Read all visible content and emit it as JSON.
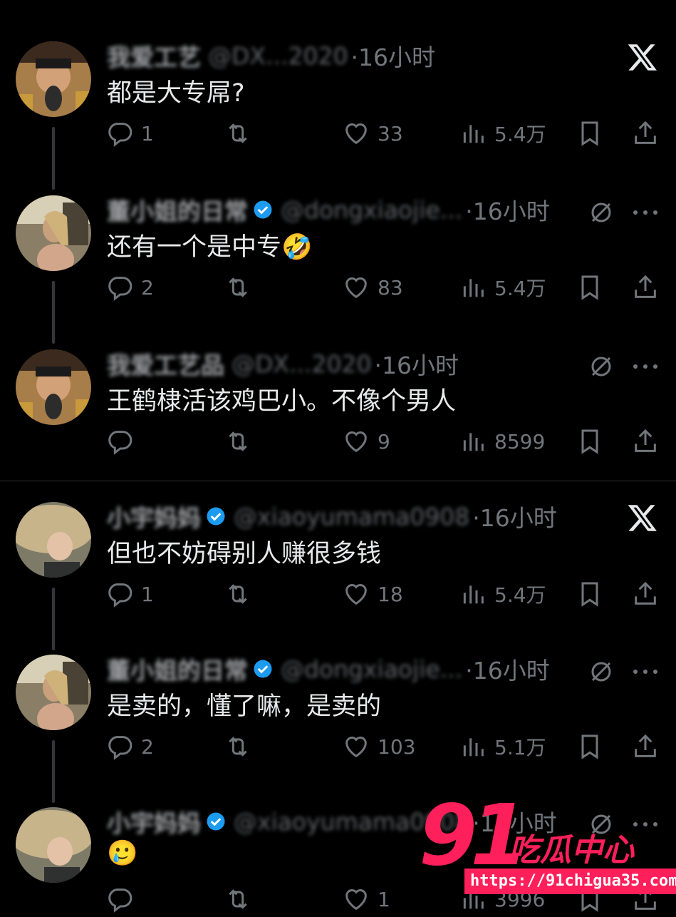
{
  "colors": {
    "background": "#000000",
    "text": "#e7e9ea",
    "muted": "#71767b",
    "verified": "#1d9bf0",
    "watermark": "#ff1f5a"
  },
  "threads": [
    {
      "posts": [
        {
          "name": "我爱工艺",
          "handle": "@DX...2020",
          "time": "·16小时",
          "text": "都是大专屌?",
          "replies": "1",
          "retweets": "",
          "likes": "33",
          "views": "5.4万",
          "corner": "x-logo",
          "verified": false,
          "avatar": "man"
        },
        {
          "name": "董小姐的日常",
          "handle": "@dongxiaojie...",
          "time": "·16小时",
          "text": "还有一个是中专🤣",
          "replies": "2",
          "retweets": "",
          "likes": "83",
          "views": "5.4万",
          "corner": "grok",
          "verified": true,
          "avatar": "woman"
        },
        {
          "name": "我爱工艺品",
          "handle": "@DX...2020",
          "time": "·16小时",
          "text": "王鹤棣活该鸡巴小。不像个男人",
          "replies": "",
          "retweets": "",
          "likes": "9",
          "views": "8599",
          "corner": "grok",
          "verified": false,
          "avatar": "man"
        }
      ]
    },
    {
      "posts": [
        {
          "name": "小宇妈妈",
          "handle": "@xiaoyumama0908",
          "time": "·16小时",
          "text": "但也不妨碍别人赚很多钱",
          "replies": "1",
          "retweets": "",
          "likes": "18",
          "views": "5.4万",
          "corner": "x-logo",
          "verified": true,
          "avatar": "hat"
        },
        {
          "name": "董小姐的日常",
          "handle": "@dongxiaojie...",
          "time": "·16小时",
          "text": "是卖的，懂了嘛，是卖的",
          "replies": "2",
          "retweets": "",
          "likes": "103",
          "views": "5.1万",
          "corner": "grok",
          "verified": true,
          "avatar": "woman"
        },
        {
          "name": "小宇妈妈",
          "handle": "@xiaoyumama0908",
          "time": "·16小时",
          "text": "🥲",
          "replies": "",
          "retweets": "",
          "likes": "1",
          "views": "3996",
          "corner": "grok",
          "verified": true,
          "avatar": "hat"
        }
      ]
    }
  ],
  "watermark": {
    "number": "91",
    "brand": "吃瓜中心",
    "url": "https://91chigua35.com"
  }
}
